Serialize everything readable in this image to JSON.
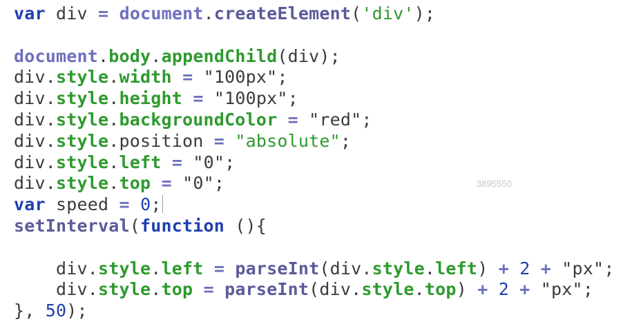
{
  "watermark": "3895550",
  "code": {
    "l1": [
      "var",
      " div ",
      "=",
      " ",
      "document",
      ".",
      "createElement",
      "(",
      "'div'",
      ");"
    ],
    "l3": [
      "document",
      ".",
      "body",
      ".",
      "appendChild",
      "(div);"
    ],
    "l4": [
      "div.",
      "style",
      ".",
      "width",
      " ",
      "=",
      " ",
      "\"100px\"",
      ";"
    ],
    "l5": [
      "div.",
      "style",
      ".",
      "height",
      " ",
      "=",
      " ",
      "\"100px\"",
      ";"
    ],
    "l6": [
      "div.",
      "style",
      ".",
      "backgroundColor",
      " ",
      "=",
      " ",
      "\"red\"",
      ";"
    ],
    "l7": [
      "div.",
      "style",
      ".position ",
      "=",
      " ",
      "\"absolute\"",
      ";"
    ],
    "l8": [
      "div.",
      "style",
      ".",
      "left",
      " ",
      "=",
      " ",
      "\"0\"",
      ";"
    ],
    "l9": [
      "div.",
      "style",
      ".",
      "top",
      " ",
      "=",
      " ",
      "\"0\"",
      ";"
    ],
    "l10": [
      "var",
      " speed ",
      "=",
      " ",
      "0",
      ";"
    ],
    "l11": [
      "setInterval",
      "(",
      "function",
      " (){"
    ],
    "l13": [
      "    div.",
      "style",
      ".",
      "left",
      " ",
      "=",
      " ",
      "parseInt",
      "(div.",
      "style",
      ".",
      "left",
      ") ",
      "+",
      " ",
      "2",
      " ",
      "+",
      " ",
      "\"px\"",
      ";"
    ],
    "l14": [
      "    div.",
      "style",
      ".",
      "top",
      " ",
      "=",
      " ",
      "parseInt",
      "(div.",
      "style",
      ".",
      "top",
      ") ",
      "+",
      " ",
      "2",
      " ",
      "+",
      " ",
      "\"px\"",
      ";"
    ],
    "l15": [
      "}, ",
      "50",
      ");"
    ]
  }
}
